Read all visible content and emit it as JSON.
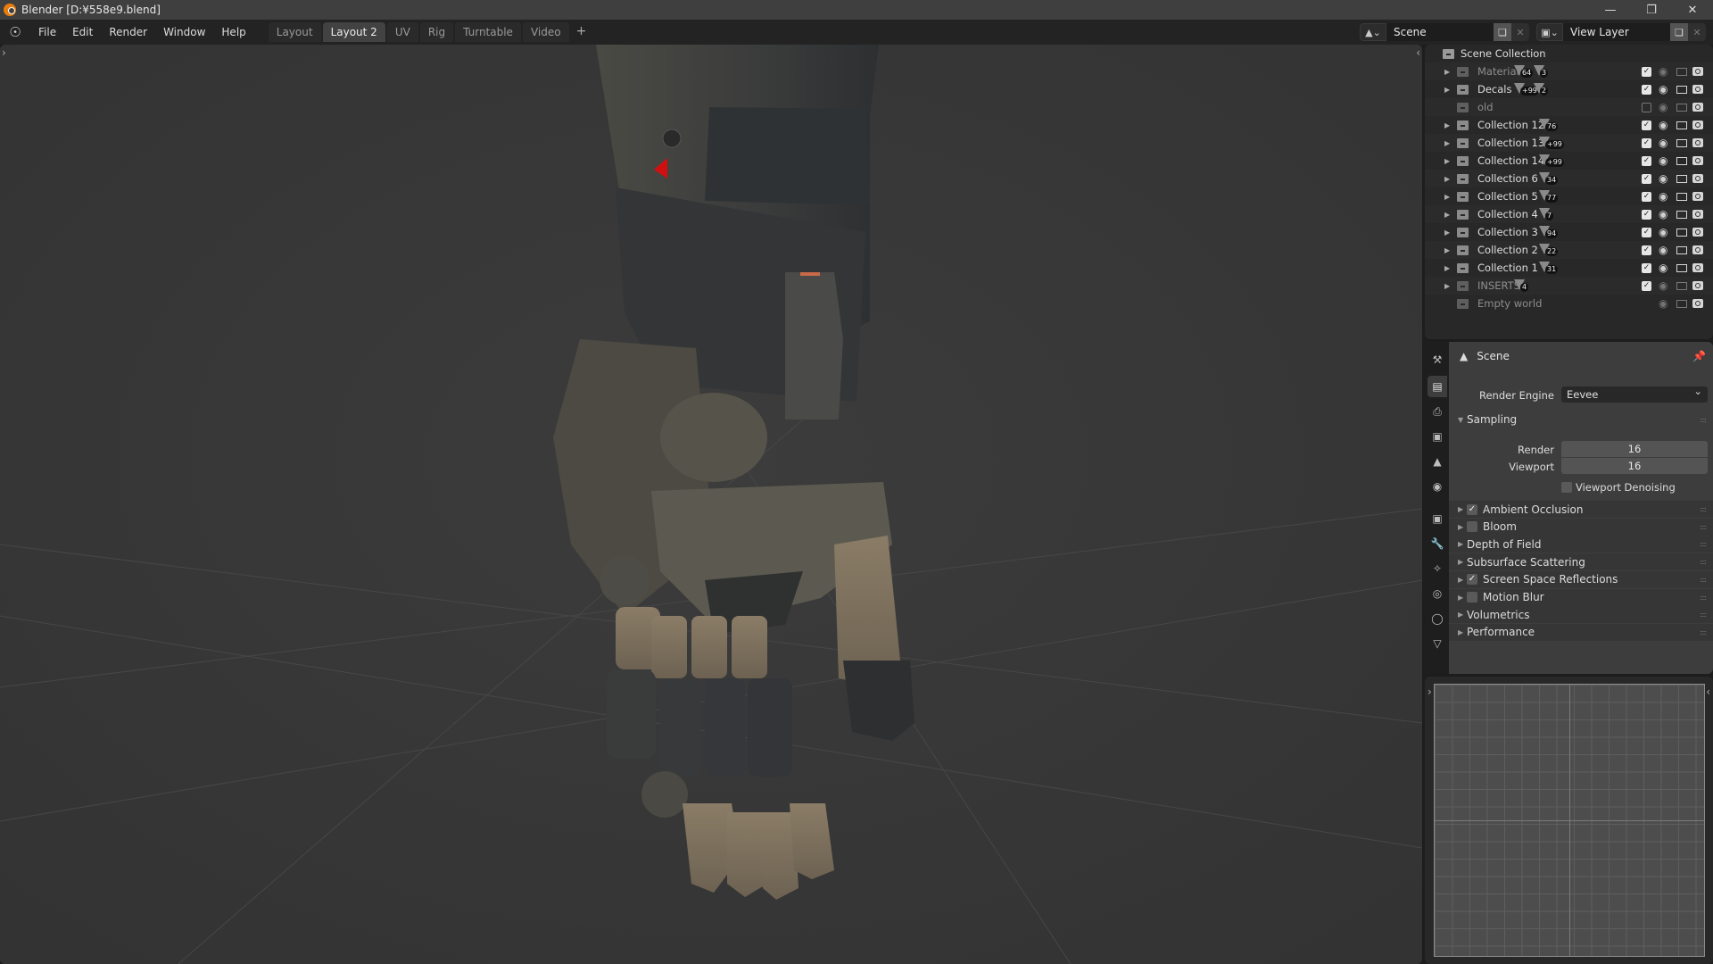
{
  "window": {
    "title": "Blender [D:¥558e9.blend]",
    "controls": [
      "minimize",
      "restore",
      "close"
    ]
  },
  "menubar": {
    "menus": [
      "File",
      "Edit",
      "Render",
      "Window",
      "Help"
    ],
    "workspaces": [
      {
        "label": "Layout",
        "active": false
      },
      {
        "label": "Layout 2",
        "active": true
      },
      {
        "label": "UV",
        "active": false
      },
      {
        "label": "Rig",
        "active": false
      },
      {
        "label": "Turntable",
        "active": false
      },
      {
        "label": "Video",
        "active": false
      }
    ],
    "add_workspace": "+",
    "scene": "Scene",
    "view_layer": "View Layer"
  },
  "outliner": {
    "root": "Scene Collection",
    "rows": [
      {
        "name": "Material",
        "expandable": true,
        "dim": true,
        "badges": [
          "64",
          "3"
        ],
        "enabled": true
      },
      {
        "name": "Decals",
        "expandable": true,
        "dim": false,
        "badges": [
          "+99",
          "2"
        ],
        "enabled": true
      },
      {
        "name": "old",
        "expandable": false,
        "dim": true,
        "badges": [],
        "enabled": false
      },
      {
        "name": "Collection 12",
        "expandable": true,
        "dim": false,
        "badges": [
          "76"
        ],
        "enabled": true
      },
      {
        "name": "Collection 13",
        "expandable": true,
        "dim": false,
        "badges": [
          "+99"
        ],
        "enabled": true
      },
      {
        "name": "Collection 14",
        "expandable": true,
        "dim": false,
        "badges": [
          "+99"
        ],
        "enabled": true
      },
      {
        "name": "Collection 6",
        "expandable": true,
        "dim": false,
        "badges": [
          "34"
        ],
        "enabled": true
      },
      {
        "name": "Collection 5",
        "expandable": true,
        "dim": false,
        "badges": [
          "77"
        ],
        "enabled": true
      },
      {
        "name": "Collection 4",
        "expandable": true,
        "dim": false,
        "badges": [
          "7"
        ],
        "enabled": true
      },
      {
        "name": "Collection 3",
        "expandable": true,
        "dim": false,
        "badges": [
          "94"
        ],
        "enabled": true
      },
      {
        "name": "Collection 2",
        "expandable": true,
        "dim": false,
        "badges": [
          "22"
        ],
        "enabled": true
      },
      {
        "name": "Collection 1",
        "expandable": true,
        "dim": false,
        "badges": [
          "31"
        ],
        "enabled": true
      },
      {
        "name": "INSERTS",
        "expandable": true,
        "dim": true,
        "badges": [
          "4"
        ],
        "enabled": true
      },
      {
        "name": "Empty world",
        "expandable": false,
        "dim": true,
        "badges": [],
        "enabled": null
      }
    ]
  },
  "properties": {
    "context": "Scene",
    "render_engine_label": "Render Engine",
    "render_engine": "Eevee",
    "sampling": {
      "title": "Sampling",
      "render_label": "Render",
      "render_value": "16",
      "viewport_label": "Viewport",
      "viewport_value": "16",
      "denoise_label": "Viewport Denoising",
      "denoise_checked": false
    },
    "panels": [
      {
        "label": "Ambient Occlusion",
        "checkbox": true,
        "checked": true
      },
      {
        "label": "Bloom",
        "checkbox": true,
        "checked": false
      },
      {
        "label": "Depth of Field",
        "checkbox": false
      },
      {
        "label": "Subsurface Scattering",
        "checkbox": false
      },
      {
        "label": "Screen Space Reflections",
        "checkbox": true,
        "checked": true
      },
      {
        "label": "Motion Blur",
        "checkbox": true,
        "checked": false
      },
      {
        "label": "Volumetrics",
        "checkbox": false
      },
      {
        "label": "Performance",
        "checkbox": false
      }
    ],
    "tabs": [
      "tool",
      "render",
      "output",
      "view-layer",
      "scene",
      "world",
      "object",
      "modifiers",
      "particles",
      "physics",
      "constraints",
      "data"
    ]
  },
  "colors": {
    "accent_orange": "#e87d0d",
    "checkbox": "#e6e6e6",
    "arrow_red": "#d01010"
  }
}
